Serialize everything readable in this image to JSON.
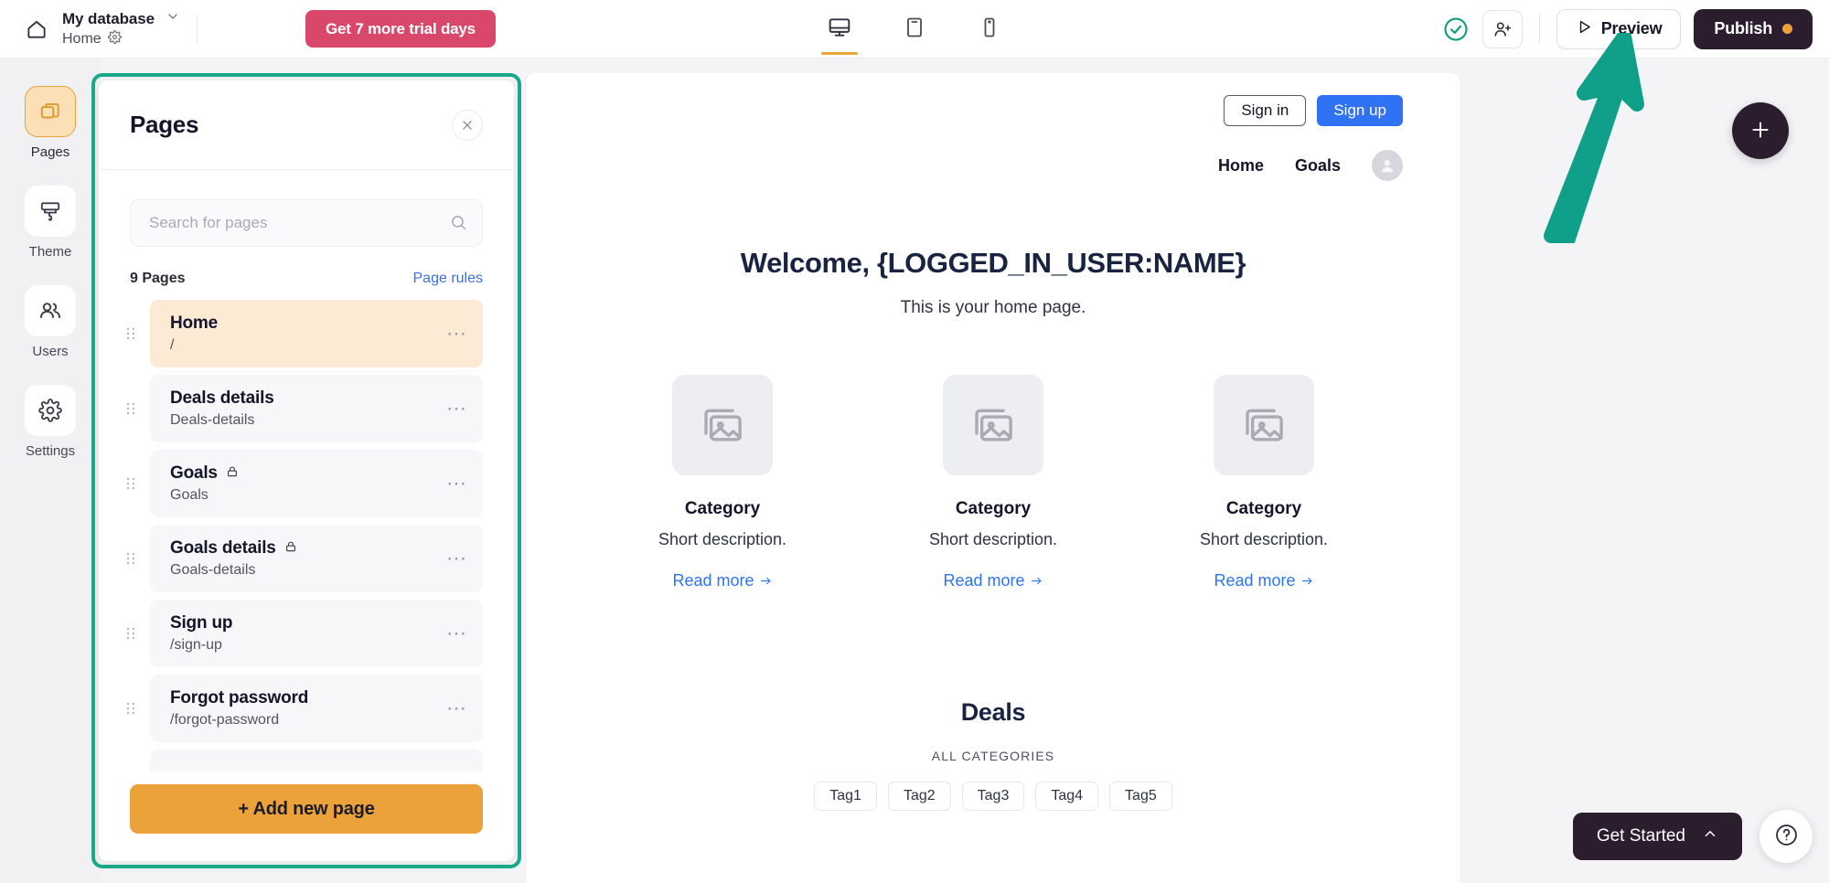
{
  "topbar": {
    "home_icon": "home-icon",
    "database_name": "My database",
    "database_chevron": "chevron-down-icon",
    "breadcrumb_page": "Home",
    "breadcrumb_gear": "gear-icon",
    "trial_button": "Get 7 more trial days",
    "devices": [
      {
        "name": "desktop-icon",
        "label": "Desktop",
        "active": true
      },
      {
        "name": "tablet-icon",
        "label": "Tablet",
        "active": false
      },
      {
        "name": "mobile-icon",
        "label": "Mobile",
        "active": false
      }
    ],
    "status_icon": "check-circle-icon",
    "invite_icon": "add-user-icon",
    "preview_button": "Preview",
    "preview_icon": "play-icon",
    "publish_button": "Publish",
    "publish_dot_color": "#eba23b"
  },
  "rail": {
    "items": [
      {
        "label": "Pages",
        "icon": "pages-icon",
        "active": true
      },
      {
        "label": "Theme",
        "icon": "brush-icon",
        "active": false
      },
      {
        "label": "Users",
        "icon": "users-icon",
        "active": false
      },
      {
        "label": "Settings",
        "icon": "gear-icon",
        "active": false
      }
    ]
  },
  "pages_panel": {
    "title": "Pages",
    "close_icon": "close-icon",
    "search_placeholder": "Search for pages",
    "search_value": "",
    "search_icon": "search-icon",
    "count_label": "9 Pages",
    "page_rules_link": "Page rules",
    "add_button": "+ Add new page",
    "items": [
      {
        "name": "Home",
        "path": "/",
        "locked": false,
        "selected": true
      },
      {
        "name": "Deals details",
        "path": "Deals-details",
        "locked": false,
        "selected": false
      },
      {
        "name": "Goals",
        "path": "Goals",
        "locked": true,
        "selected": false
      },
      {
        "name": "Goals details",
        "path": "Goals-details",
        "locked": true,
        "selected": false
      },
      {
        "name": "Sign up",
        "path": "/sign-up",
        "locked": false,
        "selected": false
      },
      {
        "name": "Forgot password",
        "path": "/forgot-password",
        "locked": false,
        "selected": false
      }
    ],
    "highlight_color": "#18a98a"
  },
  "canvas": {
    "auth": {
      "sign_in": "Sign in",
      "sign_up": "Sign up"
    },
    "nav": {
      "links": [
        "Home",
        "Goals"
      ],
      "avatar": "avatar-icon"
    },
    "hero": {
      "title": "Welcome, {LOGGED_IN_USER:NAME}",
      "subtitle": "This is your home page."
    },
    "cards": [
      {
        "thumb": "image-placeholder-icon",
        "title": "Category",
        "description": "Short description.",
        "link": "Read more"
      },
      {
        "thumb": "image-placeholder-icon",
        "title": "Category",
        "description": "Short description.",
        "link": "Read more"
      },
      {
        "thumb": "image-placeholder-icon",
        "title": "Category",
        "description": "Short description.",
        "link": "Read more"
      }
    ],
    "deals": {
      "title": "Deals",
      "subtitle": "ALL CATEGORIES",
      "tags": [
        "Tag1",
        "Tag2",
        "Tag3",
        "Tag4",
        "Tag5"
      ]
    },
    "add_fab_icon": "plus-icon"
  },
  "floating": {
    "get_started": "Get Started",
    "get_started_chevron": "chevron-up-icon",
    "help_icon": "question-mark-icon"
  },
  "annotation": {
    "arrow_icon": "arrow-up-right-annotation",
    "arrow_color": "#10a08a"
  }
}
